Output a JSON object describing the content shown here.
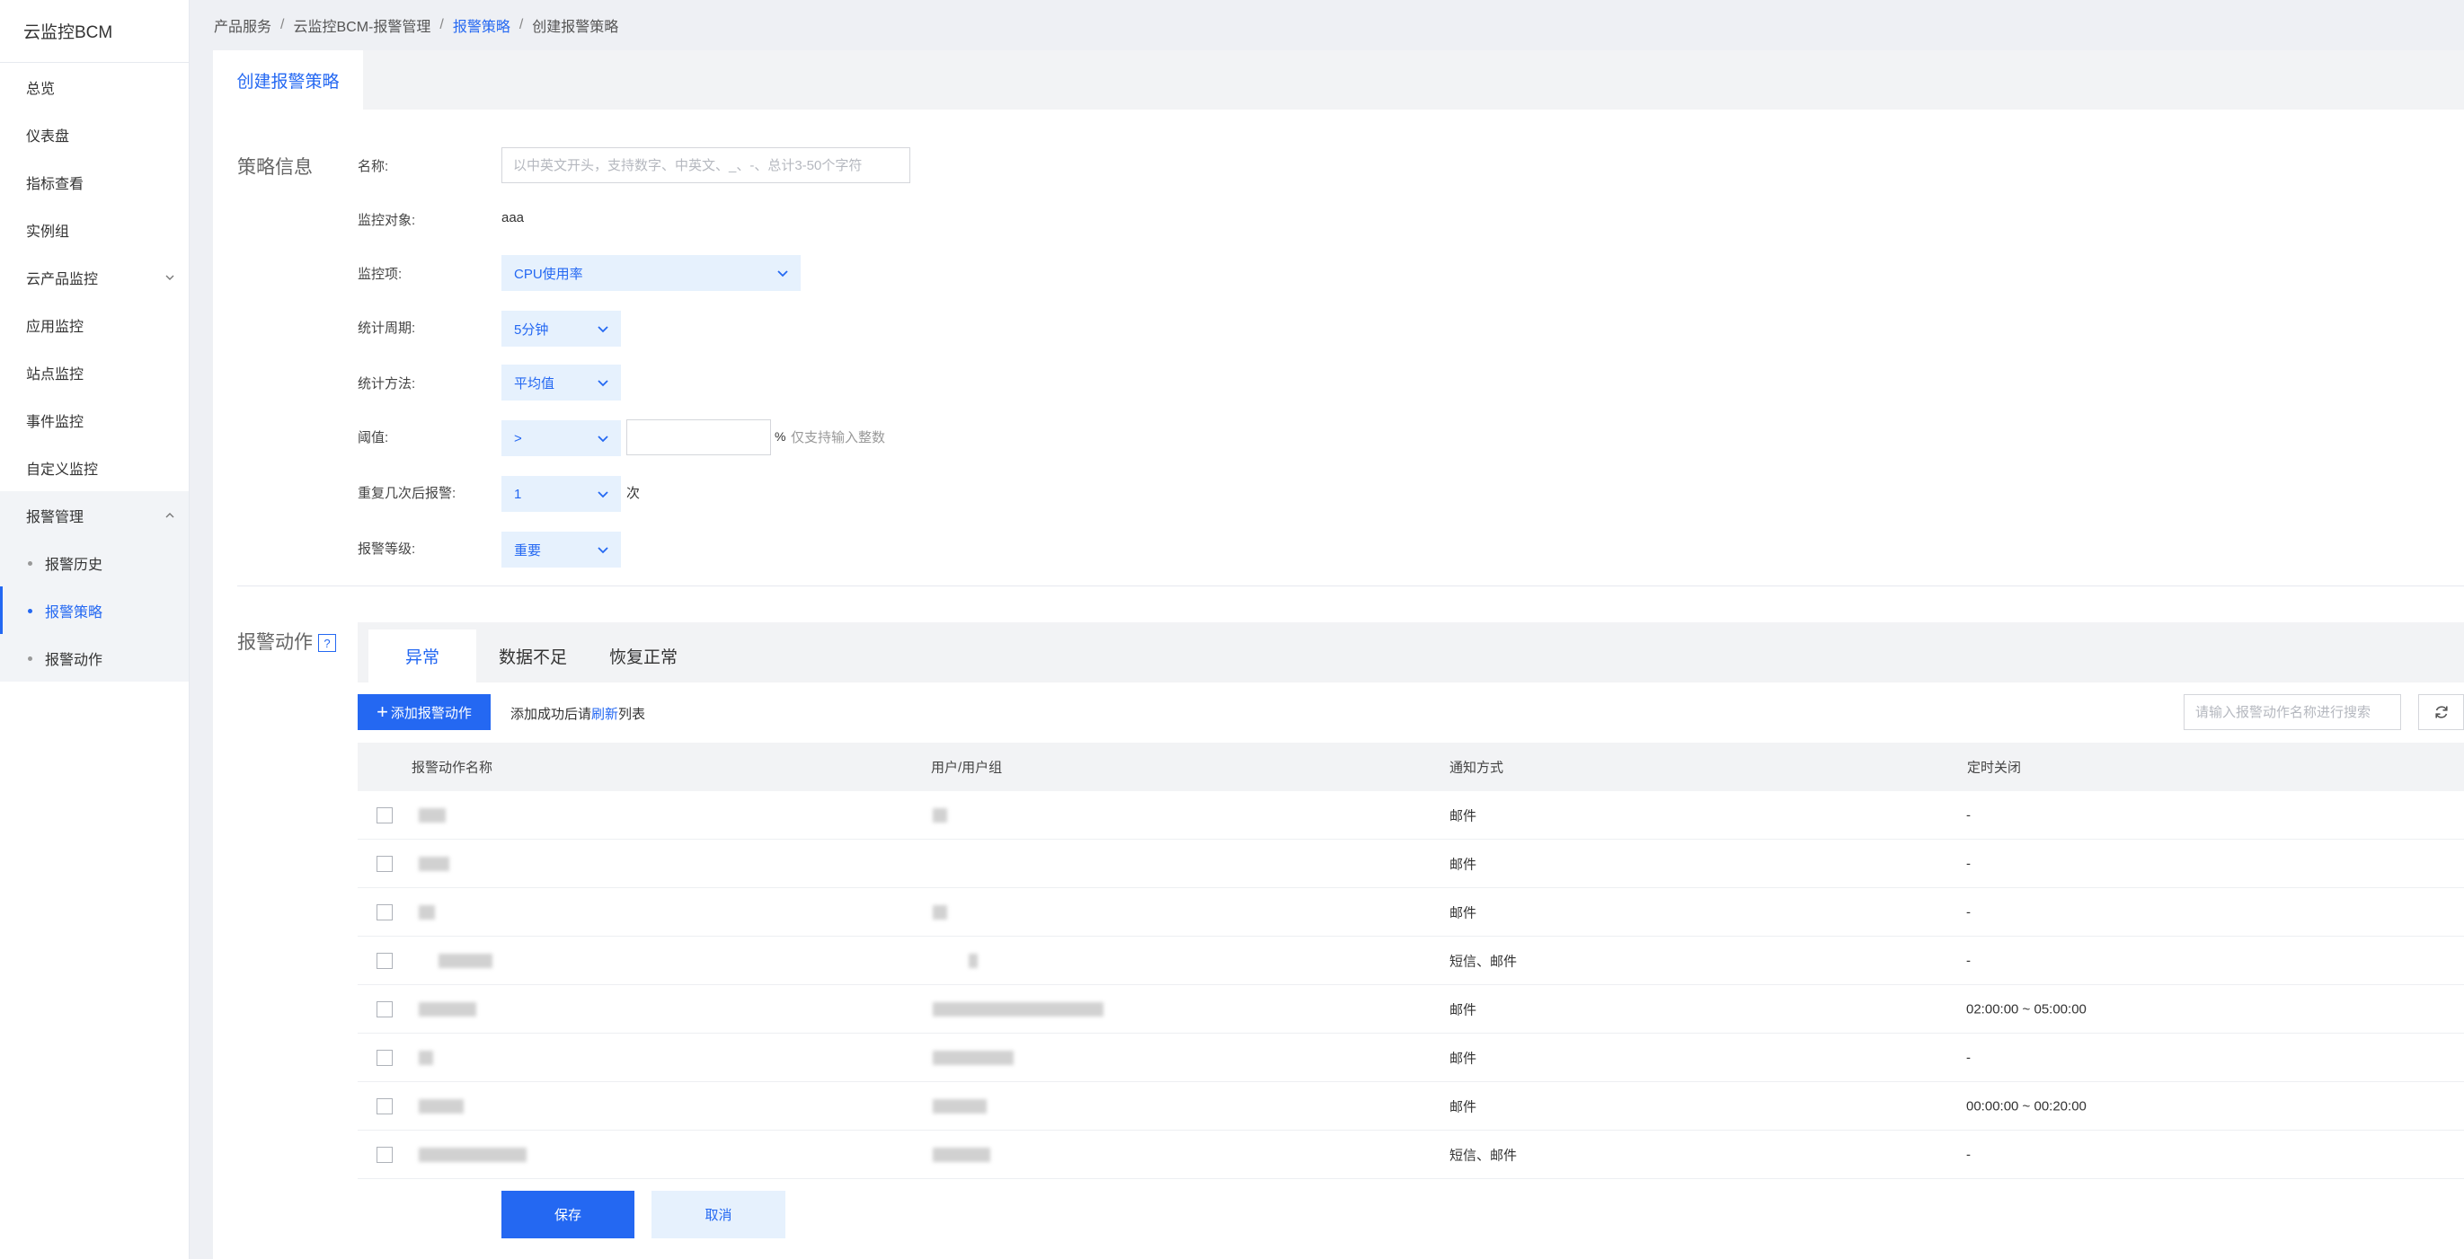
{
  "sidebar": {
    "brand": "云监控BCM",
    "items": [
      {
        "label": "总览"
      },
      {
        "label": "仪表盘"
      },
      {
        "label": "指标查看"
      },
      {
        "label": "实例组"
      },
      {
        "label": "云产品监控"
      },
      {
        "label": "应用监控"
      },
      {
        "label": "站点监控"
      },
      {
        "label": "事件监控"
      },
      {
        "label": "自定义监控"
      },
      {
        "label": "报警管理"
      }
    ],
    "sub_items": [
      {
        "label": "报警历史"
      },
      {
        "label": "报警策略"
      },
      {
        "label": "报警动作"
      }
    ]
  },
  "breadcrumb": {
    "items": [
      "产品服务",
      "云监控BCM-报警管理",
      "报警策略",
      "创建报警策略"
    ]
  },
  "page_tab": "创建报警策略",
  "policy": {
    "section_title": "策略信息",
    "name_label": "名称:",
    "name_placeholder": "以中英文开头，支持数字、中英文、_、-、总计3-50个字符",
    "target_label": "监控对象:",
    "target_value": "aaa",
    "metric_label": "监控项:",
    "metric_value": "CPU使用率",
    "period_label": "统计周期:",
    "period_value": "5分钟",
    "method_label": "统计方法:",
    "method_value": "平均值",
    "threshold_label": "阈值:",
    "threshold_op": ">",
    "threshold_value": "",
    "threshold_unit": "%",
    "threshold_hint": "仅支持输入整数",
    "repeat_label": "重复几次后报警:",
    "repeat_value": "1",
    "repeat_unit": "次",
    "level_label": "报警等级:",
    "level_value": "重要"
  },
  "actions": {
    "section_title": "报警动作",
    "help": "?",
    "tabs": [
      "异常",
      "数据不足",
      "恢复正常"
    ],
    "add_button": "添加报警动作",
    "refresh_hint_before": "添加成功后请",
    "refresh_link": "刷新",
    "refresh_hint_after": "列表",
    "search_placeholder": "请输入报警动作名称进行搜索",
    "columns": [
      "报警动作名称",
      "用户/用户组",
      "通知方式",
      "定时关闭"
    ],
    "rows": [
      {
        "notify": "邮件",
        "schedule": "-"
      },
      {
        "notify": "邮件",
        "schedule": "-"
      },
      {
        "notify": "邮件",
        "schedule": "-"
      },
      {
        "notify": "短信、邮件",
        "schedule": "-"
      },
      {
        "notify": "邮件",
        "schedule": "02:00:00 ~ 05:00:00"
      },
      {
        "notify": "邮件",
        "schedule": "-"
      },
      {
        "notify": "邮件",
        "schedule": "00:00:00 ~ 00:20:00"
      },
      {
        "notify": "短信、邮件",
        "schedule": "-"
      }
    ]
  },
  "footer": {
    "save": "保存",
    "cancel": "取消"
  },
  "colors": {
    "accent": "#2468f2",
    "select_bg": "#e6f1fd"
  }
}
